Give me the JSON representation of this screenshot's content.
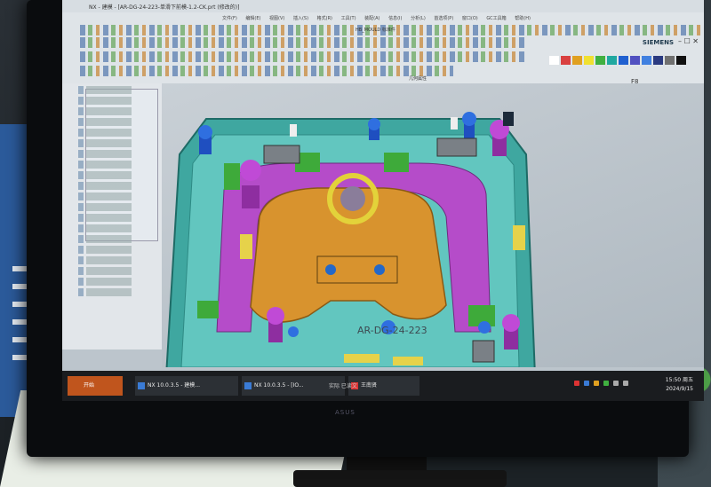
{
  "window": {
    "title": "NX - 建模 - [AR-DG-24-223-单滑下前模-1.2-CK.prt (修改的)]",
    "menus": [
      "文件(F)",
      "编辑(E)",
      "视图(V)",
      "插入(S)",
      "格式(R)",
      "工具(T)",
      "装配(A)",
      "信息(I)",
      "分析(L)",
      "首选项(P)",
      "窗口(O)",
      "GC工具箱",
      "帮助(H)"
    ],
    "brand": "SIEMENS",
    "toolbar_text_1": "HB_MOULD 标准件",
    "toolbar_text_2": "几何属性",
    "snap_value": "F8"
  },
  "palette": [
    "#ffffff",
    "#d94040",
    "#e0a020",
    "#f0e030",
    "#40b040",
    "#20a8a0",
    "#2060d0",
    "#5050c0",
    "#4080e0",
    "#2a3a80",
    "#707070",
    "#111111"
  ],
  "part": {
    "label": "AR-DG-24-223"
  },
  "taskbar": {
    "start_label": "开始",
    "items": [
      "NX 10.0.3.5 - 建模...",
      "NX 10.0.3.5 - [IO...",
      "王南贤"
    ],
    "center_text": "实际 已读文",
    "time": "15:50 周五",
    "date": "2024/9/15"
  },
  "monitor": {
    "brand": "ASUS"
  }
}
